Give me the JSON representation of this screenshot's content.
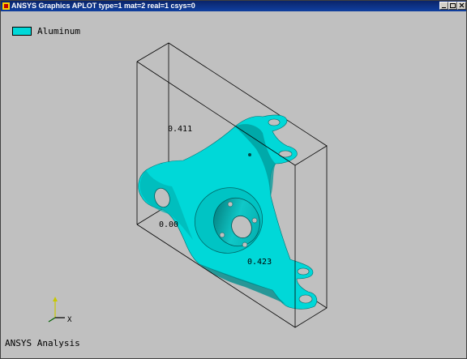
{
  "window": {
    "title": "ANSYS Graphics   APLOT  type=1 mat=2 real=1 csys=0"
  },
  "legend": {
    "label": "Aluminum",
    "color": "#00d8d8"
  },
  "bounding_box_labels": {
    "top_value": "0.411",
    "mid_value": "0.00",
    "right_value": "0.423"
  },
  "triad": {
    "x_label": "X"
  },
  "footer": {
    "text": "ANSYS Analysis"
  },
  "colors": {
    "background": "#c0c0c0",
    "part": "#00d8d8",
    "part_shadow": "#009a9a",
    "titlebar": "#0a246a"
  }
}
